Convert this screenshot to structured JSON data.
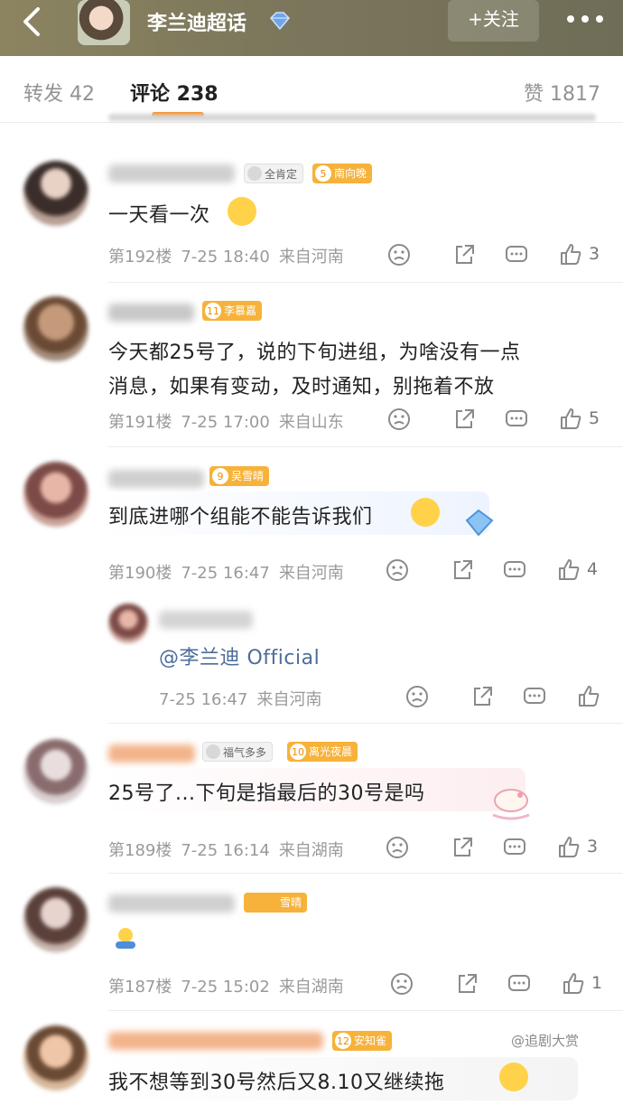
{
  "header": {
    "title": "李兰迪超话",
    "follow_label": "+关注",
    "colors": {
      "bar": "#7d785c",
      "accent": "#ff8200"
    }
  },
  "tabs": {
    "repost": "转发 42",
    "comments": "评论 238",
    "likes": "赞 1817"
  },
  "comments": [
    {
      "badges": [
        {
          "label": "全肯定",
          "num": ""
        },
        {
          "label": "南向晚",
          "num": "5"
        }
      ],
      "text": "一天看一次",
      "floor": "第192楼",
      "time": "7-25 18:40",
      "location": "来自河南",
      "likes": "3"
    },
    {
      "badges": [
        {
          "label": "李慕嘉",
          "num": "11"
        }
      ],
      "text_line1": "今天都25号了，说的下旬进组，为啥没有一点",
      "text_line2": "消息，如果有变动，及时通知，别拖着不放",
      "floor": "第191楼",
      "time": "7-25 17:00",
      "location": "来自山东",
      "likes": "5"
    },
    {
      "badges": [
        {
          "label": "吴雪晴",
          "num": "9"
        }
      ],
      "text": "到底进哪个组能不能告诉我们",
      "floor": "第190楼",
      "time": "7-25 16:47",
      "location": "来自河南",
      "likes": "4",
      "reply": {
        "text": "@李兰迪 Official",
        "time": "7-25 16:47",
        "location": "来自河南"
      }
    },
    {
      "badges": [
        {
          "label": "福气多多",
          "num": ""
        },
        {
          "label": "离光夜晨",
          "num": "10"
        }
      ],
      "text": "25号了...下旬是指最后的30号是吗",
      "floor": "第189楼",
      "time": "7-25 16:14",
      "location": "来自湖南",
      "likes": "3"
    },
    {
      "badges": [
        {
          "label": "雪晴",
          "num": ""
        }
      ],
      "text": "",
      "floor": "第187楼",
      "time": "7-25 15:02",
      "location": "来自湖南",
      "likes": "1"
    },
    {
      "badges": [
        {
          "label": "安知雀",
          "num": "12"
        }
      ],
      "text": "我不想等到30号然后又8.10又继续拖"
    }
  ],
  "watermark": "@追剧大赏"
}
